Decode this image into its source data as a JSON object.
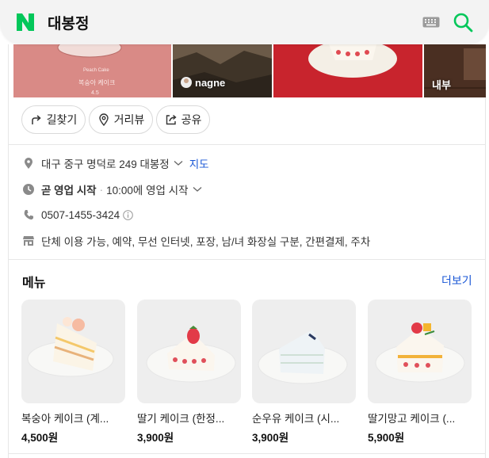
{
  "search": {
    "query": "대봉정"
  },
  "photos": {
    "cover_caption": "Peach Cake",
    "cover_title": "복숭아 케이크",
    "cover_rating": "4.5",
    "photo2_label": "nagne",
    "photo4_label": "내부"
  },
  "actions": {
    "directions": "길찾기",
    "street_view": "거리뷰",
    "share": "공유"
  },
  "info": {
    "address": "대구 중구 명덕로 249 대봉정",
    "map_link": "지도",
    "status": "곧 영업 시작",
    "hours": "10:00에 영업 시작",
    "phone": "0507-1455-3424",
    "amenities": "단체 이용 가능, 예약, 무선 인터넷, 포장, 남/녀 화장실 구분, 간편결제, 주차"
  },
  "menu": {
    "title": "메뉴",
    "more": "더보기",
    "items": [
      {
        "name": "복숭아 케이크 (계...",
        "price": "4,500원"
      },
      {
        "name": "딸기 케이크 (한정...",
        "price": "3,900원"
      },
      {
        "name": "순우유 케이크 (시...",
        "price": "3,900원"
      },
      {
        "name": "딸기망고 케이크 (...",
        "price": "5,900원"
      }
    ]
  },
  "colors": {
    "naver_green": "#03c75a",
    "link_blue": "#1a57d6"
  }
}
